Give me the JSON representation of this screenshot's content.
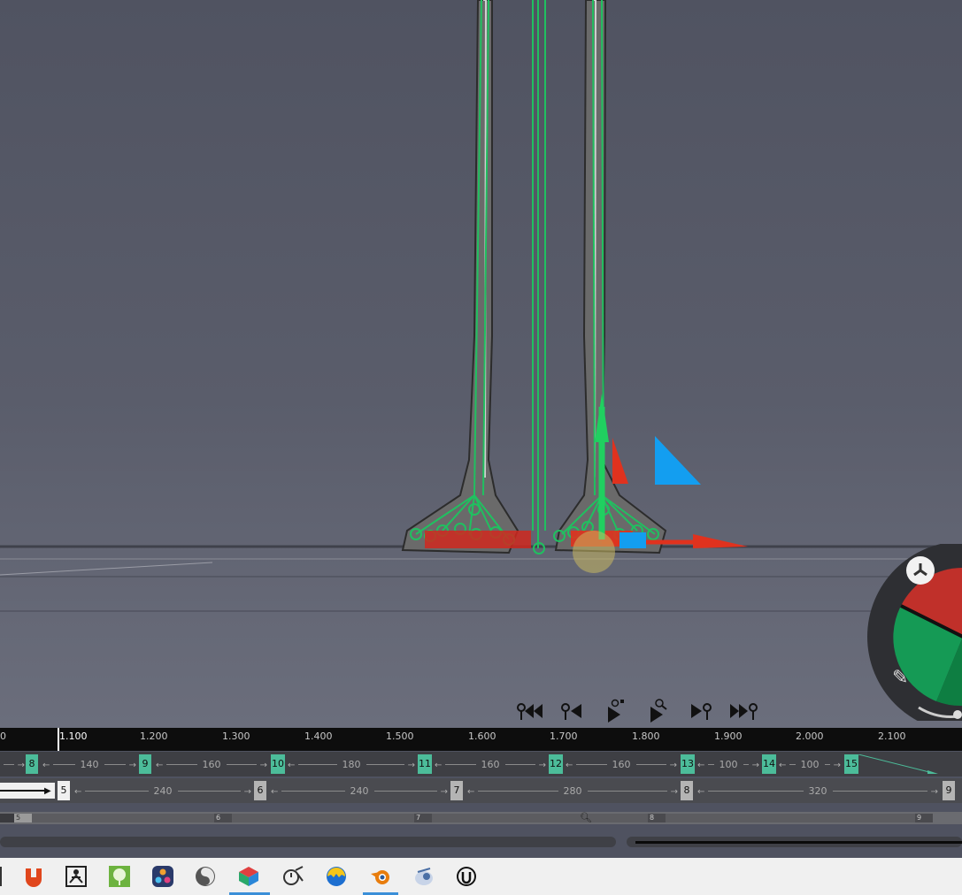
{
  "colors": {
    "viewport_bg": "#545765",
    "rig_green": "#20c060",
    "gizmo_red": "#e0321e",
    "gizmo_blue": "#139ef0",
    "key_teal": "#4cbc9a",
    "timeline_bg": "#0d0d0d",
    "taskbar_bg": "#f0f0f0"
  },
  "playback": {
    "buttons": [
      {
        "name": "go-to-start-key-button",
        "icon": "skip-back-key-icon"
      },
      {
        "name": "previous-key-button",
        "icon": "step-back-key-icon"
      },
      {
        "name": "play-record-button",
        "icon": "play-record-icon"
      },
      {
        "name": "play-button",
        "icon": "play-search-icon"
      },
      {
        "name": "next-key-button",
        "icon": "step-forward-key-icon"
      },
      {
        "name": "go-to-end-key-button",
        "icon": "skip-forward-key-icon"
      }
    ]
  },
  "timeline": {
    "ruler_ticks": [
      "0",
      "1.100",
      "1.200",
      "1.300",
      "1.400",
      "1.500",
      "1.600",
      "1.700",
      "1.800",
      "1.900",
      "2.000",
      "2.100"
    ],
    "playhead_value": "1.100",
    "track1_keys": [
      "8",
      "9",
      "10",
      "11",
      "12",
      "13",
      "14",
      "15"
    ],
    "track1_spans": [
      "140",
      "160",
      "180",
      "160",
      "160",
      "100",
      "100"
    ],
    "track2_keys": [
      "5",
      "6",
      "7",
      "8",
      "9"
    ],
    "track2_spans": [
      "240",
      "240",
      "280",
      "320"
    ],
    "scrub_labels": [
      "5",
      "6",
      "7",
      "8",
      "9"
    ]
  },
  "taskbar": {
    "apps": [
      {
        "icon": "marmoset-icon",
        "color": "#e0461c"
      },
      {
        "icon": "zbrush-icon",
        "color": "#222222"
      },
      {
        "icon": "speedtree-icon",
        "color": "#6db33f"
      },
      {
        "icon": "davinci-resolve-icon",
        "color": "#2a3a6a"
      },
      {
        "icon": "sculpt-app-icon",
        "color": "#555555"
      },
      {
        "icon": "cascadeur-icon",
        "color": "#2aa86a",
        "active": true
      },
      {
        "icon": "settings-tool-icon",
        "color": "#333333"
      },
      {
        "icon": "blob-app-icon",
        "color": "#1d6fd0"
      },
      {
        "icon": "blender-icon",
        "color": "#e87d0d",
        "active": true
      },
      {
        "icon": "robot-app-icon",
        "color": "#4a6fa5"
      },
      {
        "icon": "unreal-engine-icon",
        "color": "#111111"
      }
    ]
  }
}
